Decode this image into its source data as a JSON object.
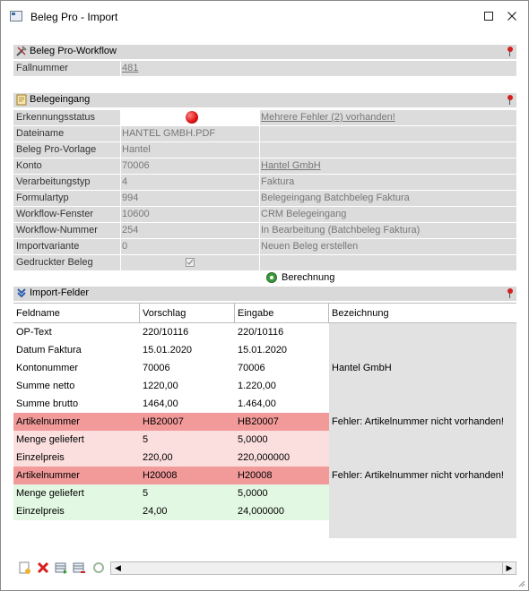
{
  "window": {
    "title": "Beleg Pro - Import"
  },
  "workflow": {
    "title": "Beleg Pro-Workflow",
    "fallnummer_label": "Fallnummer",
    "fallnummer_value": "481"
  },
  "belegeingang": {
    "title": "Belegeingang",
    "rows": [
      {
        "key": "Erkennungsstatus",
        "value": "",
        "value2": "Mehrere Fehler (2) vorhanden!"
      },
      {
        "key": "Dateiname",
        "value": "HANTEL GMBH.PDF",
        "value2": ""
      },
      {
        "key": "Beleg Pro-Vorlage",
        "value": "Hantel",
        "value2": ""
      },
      {
        "key": "Konto",
        "value": "70006",
        "value2": "Hantel GmbH"
      },
      {
        "key": "Verarbeitungstyp",
        "value": "4",
        "value2": "Faktura"
      },
      {
        "key": "Formulartyp",
        "value": "994",
        "value2": "Belegeingang Batchbeleg Faktura"
      },
      {
        "key": "Workflow-Fenster",
        "value": "10600",
        "value2": "CRM Belegeingang"
      },
      {
        "key": "Workflow-Nummer",
        "value": "254",
        "value2": "In Bearbeitung (Batchbeleg Faktura)"
      },
      {
        "key": "Importvariante",
        "value": "0",
        "value2": "Neuen Beleg erstellen"
      },
      {
        "key": "Gedruckter Beleg",
        "value": "",
        "value2": ""
      }
    ],
    "status_color": "#d81010",
    "berechnung_label": "Berechnung"
  },
  "import_felder": {
    "title": "Import-Felder",
    "columns": [
      "Feldname",
      "Vorschlag",
      "Eingabe",
      "Bezeichnung"
    ],
    "rows": [
      {
        "feldname": "OP-Text",
        "vorschlag": "220/10116",
        "eingabe": "220/10116",
        "bezeichnung": "",
        "style": "white"
      },
      {
        "feldname": "Datum Faktura",
        "vorschlag": "15.01.2020",
        "eingabe": "15.01.2020",
        "bezeichnung": "",
        "style": "white"
      },
      {
        "feldname": "Kontonummer",
        "vorschlag": "70006",
        "eingabe": "70006",
        "bezeichnung": "Hantel GmbH",
        "style": "white"
      },
      {
        "feldname": "Summe netto",
        "vorschlag": "1220,00",
        "eingabe": "1.220,00",
        "bezeichnung": "",
        "style": "white"
      },
      {
        "feldname": "Summe brutto",
        "vorschlag": "1464,00",
        "eingabe": "1.464,00",
        "bezeichnung": "",
        "style": "white"
      },
      {
        "feldname": "Artikelnummer",
        "vorschlag": "HB20007",
        "eingabe": "HB20007",
        "bezeichnung": "Fehler: Artikelnummer nicht vorhanden!",
        "style": "error"
      },
      {
        "feldname": "Menge geliefert",
        "vorschlag": "5",
        "eingabe": "5,0000",
        "bezeichnung": "",
        "style": "error-light"
      },
      {
        "feldname": "Einzelpreis",
        "vorschlag": "220,00",
        "eingabe": "220,000000",
        "bezeichnung": "",
        "style": "error-light"
      },
      {
        "feldname": "Artikelnummer",
        "vorschlag": "H20008",
        "eingabe": "H20008",
        "bezeichnung": "Fehler: Artikelnummer nicht vorhanden!",
        "style": "error"
      },
      {
        "feldname": "Menge geliefert",
        "vorschlag": "5",
        "eingabe": "5,0000",
        "bezeichnung": "",
        "style": "ok"
      },
      {
        "feldname": "Einzelpreis",
        "vorschlag": "24,00",
        "eingabe": "24,000000",
        "bezeichnung": "",
        "style": "ok"
      }
    ],
    "colors": {
      "error": "#f29a9a",
      "error-light": "#fbdede",
      "ok": "#e2f8e2",
      "white": "#ffffff"
    }
  }
}
